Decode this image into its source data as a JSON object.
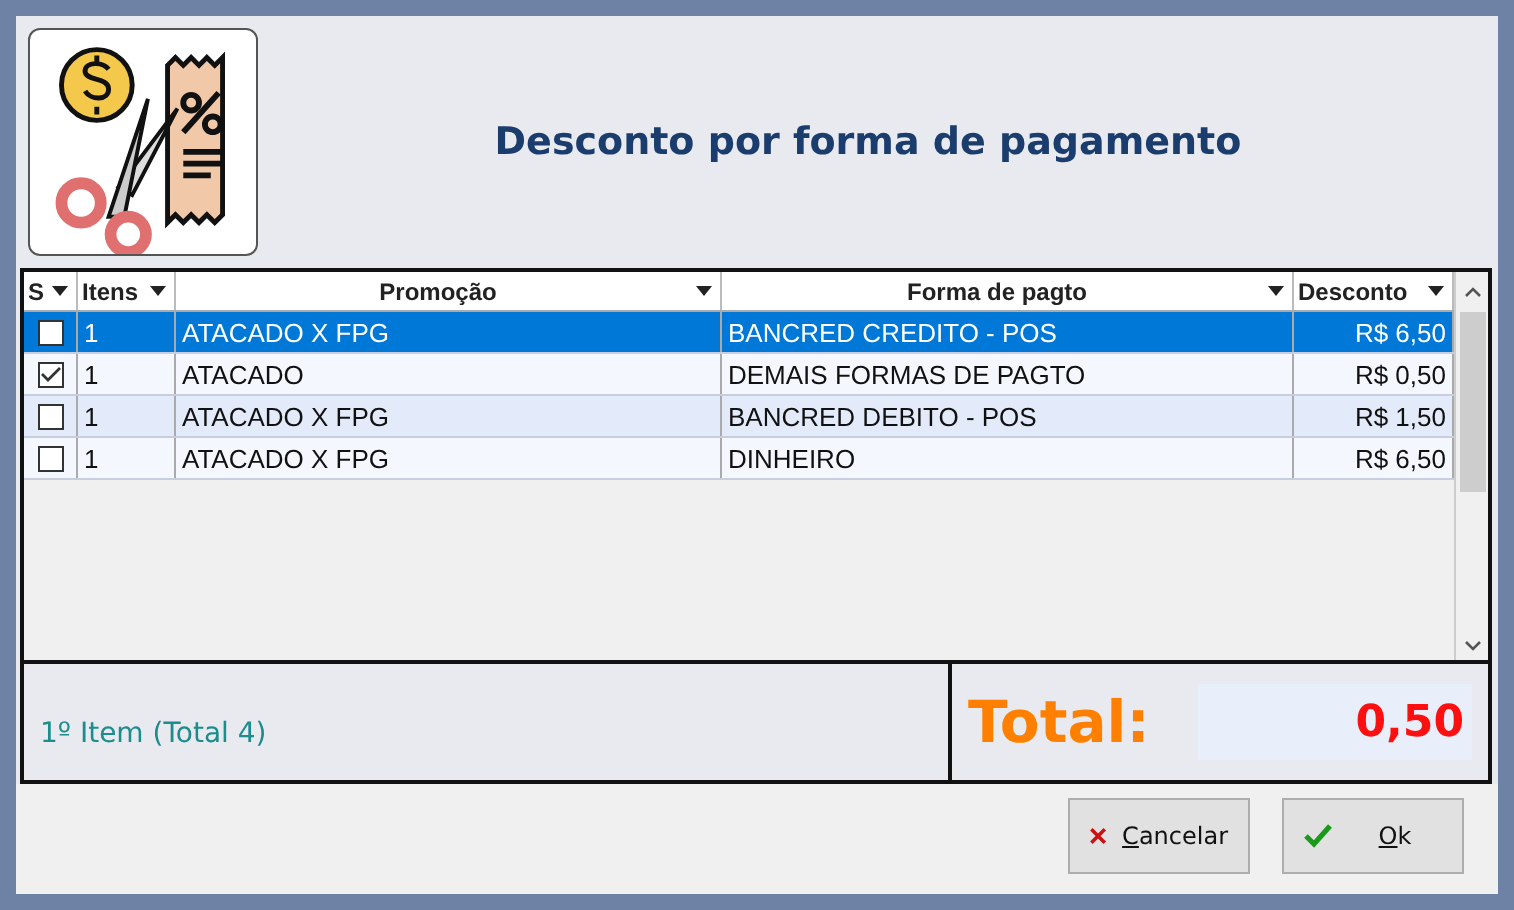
{
  "header": {
    "title": "Desconto por forma de pagamento"
  },
  "table": {
    "columns": [
      {
        "label": "S"
      },
      {
        "label": "Itens"
      },
      {
        "label": "Promoção"
      },
      {
        "label": "Forma de pagto"
      },
      {
        "label": "Desconto"
      }
    ],
    "rows": [
      {
        "checked": false,
        "selected": true,
        "itens": "1",
        "promocao": "ATACADO X FPG",
        "forma": "BANCRED CREDITO - POS",
        "desconto": "R$ 6,50"
      },
      {
        "checked": true,
        "selected": false,
        "itens": "1",
        "promocao": "ATACADO",
        "forma": "DEMAIS FORMAS DE PAGTO",
        "desconto": "R$ 0,50"
      },
      {
        "checked": false,
        "selected": false,
        "itens": "1",
        "promocao": "ATACADO X FPG",
        "forma": "BANCRED DEBITO - POS",
        "desconto": "R$ 1,50"
      },
      {
        "checked": false,
        "selected": false,
        "itens": "1",
        "promocao": "ATACADO X FPG",
        "forma": "DINHEIRO",
        "desconto": "R$ 6,50"
      }
    ]
  },
  "footer": {
    "info": "1º Item (Total 4)",
    "total_label": "Total:",
    "total_value": "0,50"
  },
  "buttons": [
    {
      "label": "Cancelar",
      "kind": "cancel"
    },
    {
      "label": "Ok",
      "kind": "ok"
    }
  ]
}
